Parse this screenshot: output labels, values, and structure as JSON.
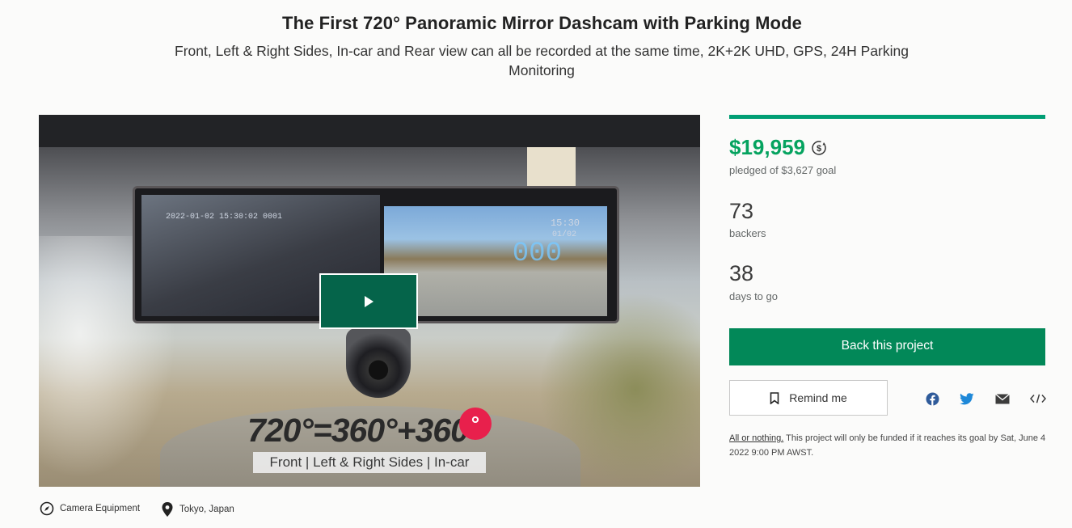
{
  "hero": {
    "title": "The First 720° Panoramic Mirror Dashcam with Parking Mode",
    "subtitle": "Front, Left & Right Sides, In-car and Rear view can all be recorded at the same time, 2K+2K UHD, GPS, 24H Parking Monitoring"
  },
  "video": {
    "overlay_text": "720°=360°+360",
    "overlay_suffix": "°",
    "caption": "Front | Left & Right Sides | In-car",
    "hud_date": "2022-01-02  15:30:02",
    "hud_code": "0001",
    "hud_time": "15:30",
    "hud_date_right": "01/02",
    "hud_speed": "000"
  },
  "meta": {
    "category": "Camera Equipment",
    "location": "Tokyo, Japan"
  },
  "funding": {
    "progress_fraction": 1.0,
    "pledged": "$19,959",
    "pledged_label": "pledged of $3,627 goal",
    "backers": "73",
    "backers_label": "backers",
    "days": "38",
    "days_label": "days to go"
  },
  "actions": {
    "back_label": "Back this project",
    "remind_label": "Remind me"
  },
  "all_or_nothing": {
    "link": "All or nothing.",
    "text": " This project will only be funded if it reaches its goal by Sat, June 4 2022 9:00 PM AWST."
  },
  "colors": {
    "accent": "#028858",
    "pledged": "#05a35f",
    "facebook": "#1877f2",
    "twitter": "#1d9bf0"
  },
  "icons": [
    "play-icon",
    "compass-icon",
    "location-pin-icon",
    "currency-convert-icon",
    "bookmark-icon",
    "facebook-icon",
    "twitter-icon",
    "email-icon",
    "embed-icon"
  ]
}
